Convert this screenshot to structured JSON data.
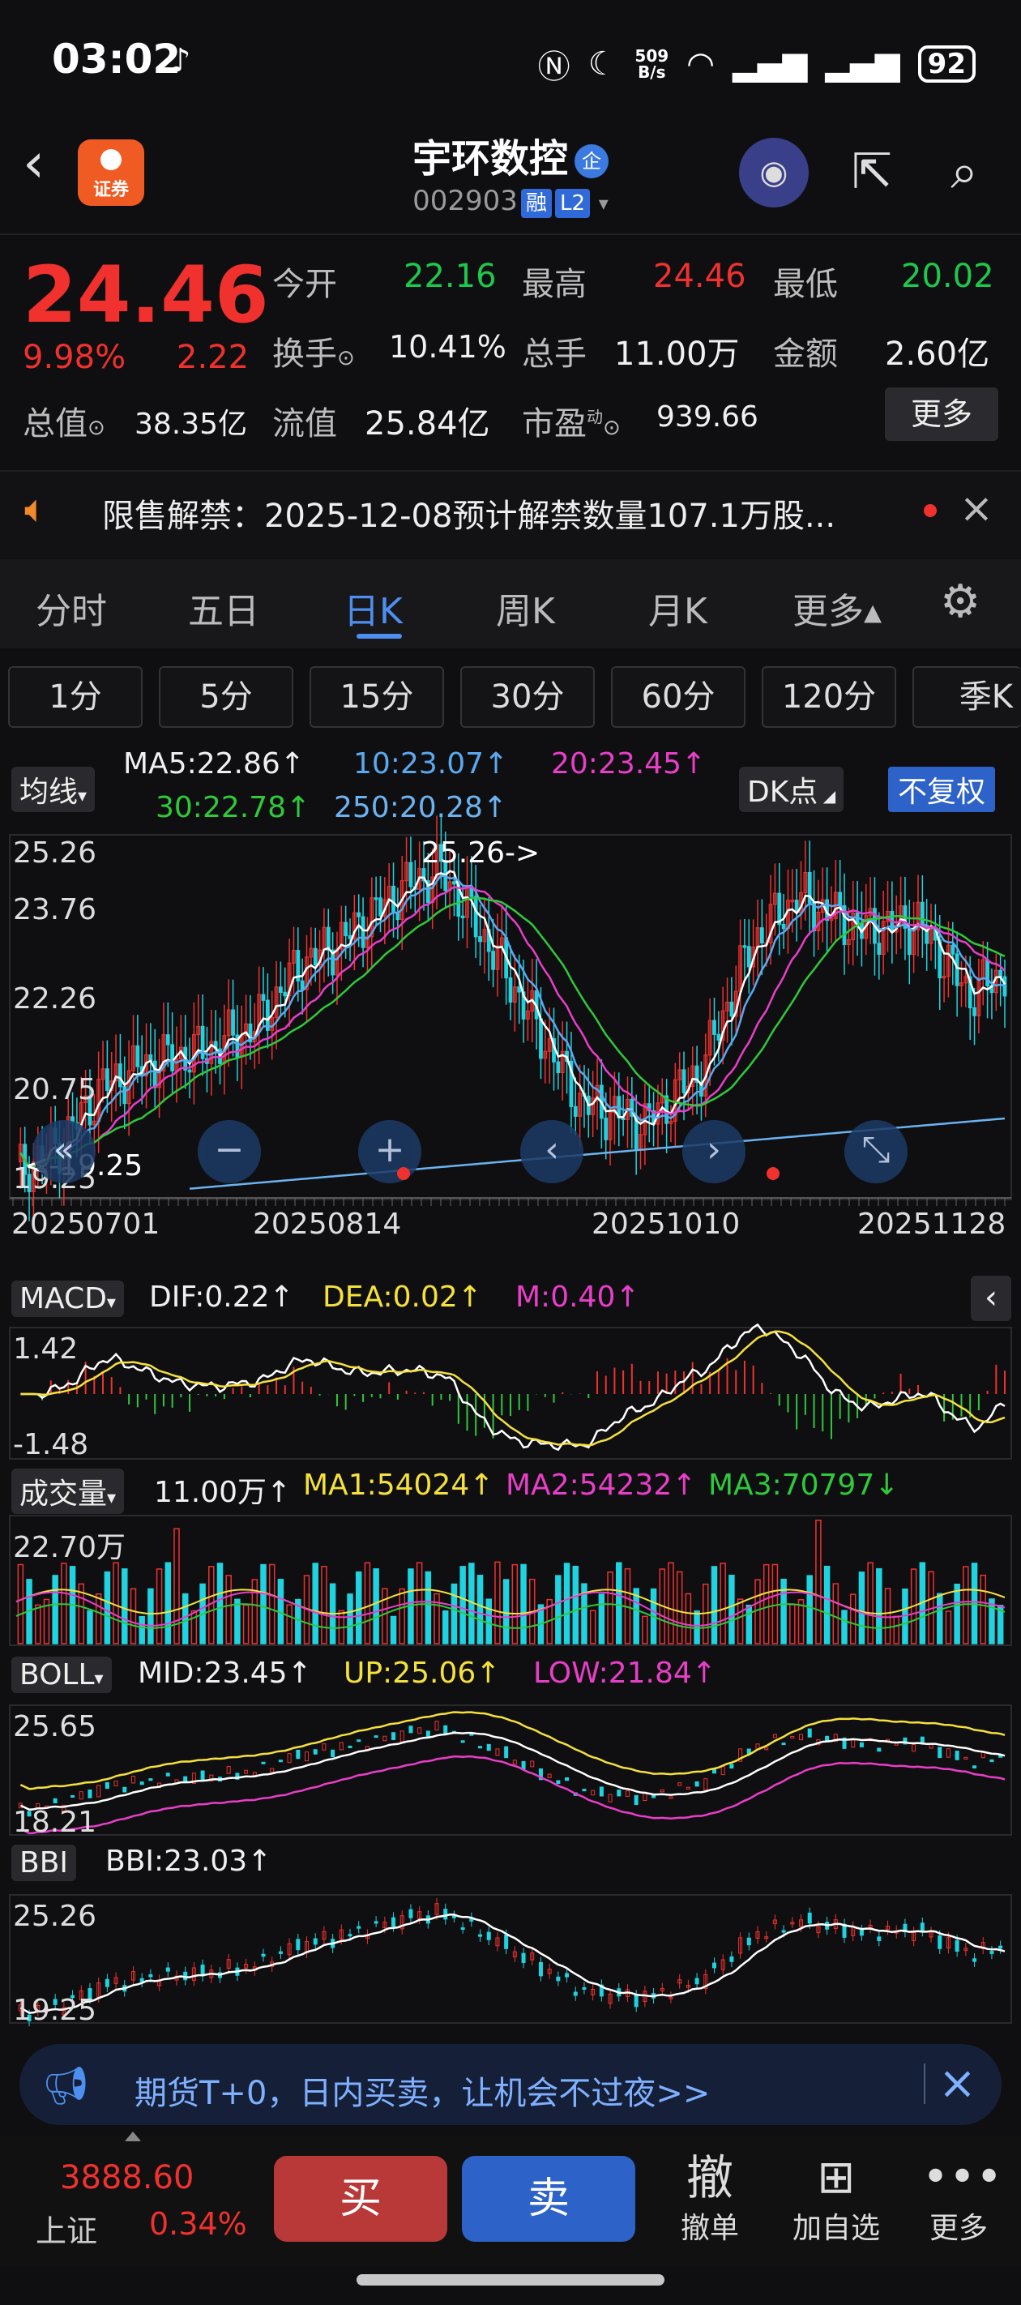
{
  "status": {
    "time": "03:02",
    "speed_top": "509",
    "speed_unit": "B/s",
    "battery": "92"
  },
  "header": {
    "badge": "证券",
    "title": "宇环数控",
    "title_tag": "企",
    "code": "002903",
    "tag_margin": "融",
    "tag_level": "L2"
  },
  "quote": {
    "price": "24.46",
    "pct": "9.98%",
    "change": "2.22",
    "rows": [
      [
        {
          "label": "今开",
          "value": "22.16",
          "color": "green"
        },
        {
          "label": "最高",
          "value": "24.46",
          "color": "red"
        },
        {
          "label": "最低",
          "value": "20.02",
          "color": "green"
        }
      ],
      [
        {
          "label": "换手",
          "value": "10.41%",
          "color": "white"
        },
        {
          "label": "总手",
          "value": "11.00万",
          "color": "white"
        },
        {
          "label": "金额",
          "value": "2.60亿",
          "color": "white"
        }
      ]
    ],
    "total_cap_label": "总值",
    "total_cap": "38.35亿",
    "float_label": "流值",
    "float_cap": "25.84亿",
    "pe_label": "市盈",
    "pe_sup": "动",
    "pe": "939.66",
    "more": "更多"
  },
  "notice": {
    "text": "限售解禁：2025-12-08预计解禁数量107.1万股..."
  },
  "tabs": [
    "分时",
    "五日",
    "日K",
    "周K",
    "月K",
    "更多▴"
  ],
  "periods": [
    "1分",
    "5分",
    "15分",
    "30分",
    "60分",
    "120分",
    "季K"
  ],
  "kline_legend": {
    "type": "均线",
    "ma5": "MA5:22.86↑",
    "ma10": "10:23.07↑",
    "ma20": "20:23.45↑",
    "ma30": "30:22.78↑",
    "ma250": "250:20.28↑",
    "dk": "DK点",
    "fq": "不复权"
  },
  "kline": {
    "y_labels": [
      "25.26",
      "23.76",
      "22.26",
      "20.75",
      "19.25"
    ],
    "high_mark": "25.26->",
    "low_mark": "<-19.25",
    "dates": [
      "20250701",
      "20250814",
      "20251010",
      "20251128"
    ]
  },
  "macd": {
    "name": "MACD",
    "dif": "DIF:0.22↑",
    "dea": "DEA:0.02↑",
    "m": "M:0.40↑",
    "ymax": "1.42",
    "ymin": "-1.48"
  },
  "vol": {
    "name": "成交量",
    "v": "11.00万↑",
    "ma1": "MA1:54024↑",
    "ma2": "MA2:54232↑",
    "ma3": "MA3:70797↓",
    "ymax": "22.70万"
  },
  "boll": {
    "name": "BOLL",
    "mid": "MID:23.45↑",
    "up": "UP:25.06↑",
    "low": "LOW:21.84↑",
    "ymax": "25.65",
    "ymin": "18.21"
  },
  "bbi": {
    "name": "BBI",
    "v": "BBI:23.03↑",
    "ymax": "25.26",
    "ymin": "19.25"
  },
  "banner": {
    "text": "期货T+0，日内买卖，让机会不过夜>>"
  },
  "bottom": {
    "index_value": "3888.60",
    "index_name": "上证",
    "index_pct": "0.34%",
    "buy": "买",
    "sell": "卖",
    "cancel_icon": "撤",
    "cancel": "撤单",
    "add": "加自选",
    "more": "更多"
  },
  "colors": {
    "up": "#f0312d",
    "down": "#1fd3e0",
    "ma5": "#ffffff",
    "ma10": "#5aa9f0",
    "ma20": "#e83ec8",
    "ma30": "#2fc93a",
    "ma250": "#6bb3f0"
  }
}
